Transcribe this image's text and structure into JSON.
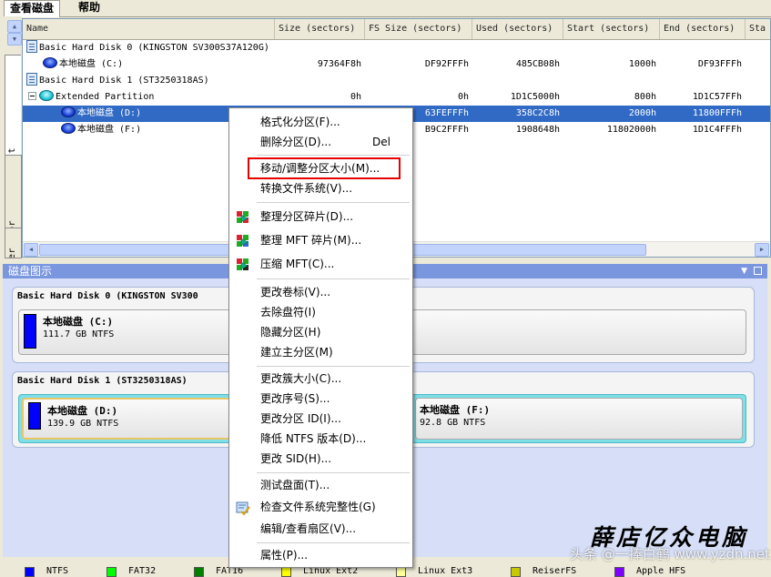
{
  "menu_tabs": [
    "查看磁盘",
    "帮助"
  ],
  "side_tabs": [
    "Partition List",
    "Disk Editor",
    "lorer"
  ],
  "columns": [
    "Name",
    "Size (sectors)",
    "FS Size (sectors)",
    "Used (sectors)",
    "Start (sectors)",
    "End (sectors)",
    "Sta"
  ],
  "rows": [
    {
      "name": "Basic Hard Disk 0 (KINGSTON SV300S37A120G)",
      "size": "",
      "fs": "",
      "used": "",
      "start": "",
      "end": ""
    },
    {
      "name": "本地磁盘 (C:)",
      "size": "97364F8h",
      "fs": "DF92FFFh",
      "used": "485CB08h",
      "start": "1000h",
      "end": "DF93FFFh"
    },
    {
      "name": "Basic Hard Disk 1 (ST3250318AS)",
      "size": "",
      "fs": "",
      "used": "",
      "start": "",
      "end": ""
    },
    {
      "name": "Extended Partition",
      "size": "0h",
      "fs": "0h",
      "used": "1D1C5000h",
      "start": "800h",
      "end": "1D1C57FFh"
    },
    {
      "name": "本地磁盘 (D:)",
      "size": "",
      "fs": "63FEFFFh",
      "used": "358C2C8h",
      "start": "2000h",
      "end": "11800FFFh"
    },
    {
      "name": "本地磁盘 (F:)",
      "size": "",
      "fs": "B9C2FFFh",
      "used": "1908648h",
      "start": "11802000h",
      "end": "1D1C4FFFh"
    }
  ],
  "disk_map": {
    "title": "磁盘图示",
    "disk0": {
      "title": "Basic Hard Disk 0 (KINGSTON SV300",
      "part_c": {
        "name": "本地磁盘 (C:)",
        "size": "111.7 GB NTFS"
      }
    },
    "disk1": {
      "title": "Basic Hard Disk 1 (ST3250318AS)",
      "part_d": {
        "name": "本地磁盘 (D:)",
        "size": "139.9 GB NTFS"
      },
      "part_f": {
        "name": "本地磁盘 (F:)",
        "size": "92.8 GB NTFS"
      }
    }
  },
  "legend": [
    {
      "label": "NTFS",
      "color": "#0000ff"
    },
    {
      "label": "FAT32",
      "color": "#00ff00"
    },
    {
      "label": "FAT16",
      "color": "#008000"
    },
    {
      "label": "Linux Ext2",
      "color": "#ffff00"
    },
    {
      "label": "Linux Ext3",
      "color": "#ffff99"
    },
    {
      "label": "ReiserFS",
      "color": "#c8c800"
    },
    {
      "label": "Apple HFS",
      "color": "#8000ff"
    }
  ],
  "context_menu": {
    "format": "格式化分区(F)...",
    "delete": "删除分区(D)...",
    "delete_shortcut": "Del",
    "move_resize": "移动/调整分区大小(M)...",
    "convert_fs": "转换文件系统(V)...",
    "defrag": "整理分区碎片(D)...",
    "defrag_mft": "整理 MFT 碎片(M)...",
    "compress_mft": "压缩 MFT(C)...",
    "change_label": "更改卷标(V)...",
    "remove_letter": "去除盘符(I)",
    "hide": "隐藏分区(H)",
    "set_primary": "建立主分区(M)",
    "cluster_size": "更改簇大小(C)...",
    "serial": "更改序号(S)...",
    "partition_id": "更改分区 ID(I)...",
    "ntfs_version": "降低 NTFS 版本(D)...",
    "sid": "更改 SID(H)...",
    "surface_test": "测试盘面(T)...",
    "check_fs": "检查文件系统完整性(G)",
    "sector_edit": "编辑/查看扇区(V)...",
    "properties": "属性(P)..."
  },
  "watermark": {
    "title": "薛店亿众电脑",
    "sub": "头条 @一捧白鹤 www.yzdn.net"
  }
}
